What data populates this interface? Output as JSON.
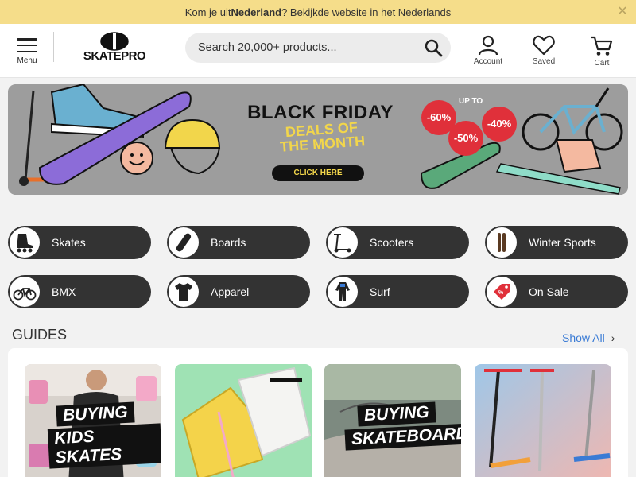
{
  "notice": {
    "prefix": "Kom je uit ",
    "country": "Nederland",
    "middle": "? Bekijk ",
    "link": "de website in het Nederlands"
  },
  "header": {
    "menu_label": "Menu",
    "logo_text": "SKATEPRO",
    "search_placeholder": "Search 20,000+ products...",
    "account_label": "Account",
    "saved_label": "Saved",
    "cart_label": "Cart"
  },
  "banner": {
    "title": "BLACK FRIDAY",
    "subtitle_line1": "DEALS OF",
    "subtitle_line2": "THE MONTH",
    "cta": "CLICK HERE",
    "up_to": "UP TO",
    "discounts": [
      "-60%",
      "-50%",
      "-40%"
    ]
  },
  "categories": [
    {
      "label": "Skates",
      "icon": "inline-skate-icon"
    },
    {
      "label": "Boards",
      "icon": "skateboard-icon"
    },
    {
      "label": "Scooters",
      "icon": "scooter-icon"
    },
    {
      "label": "Winter Sports",
      "icon": "skis-icon"
    },
    {
      "label": "BMX",
      "icon": "bmx-bike-icon"
    },
    {
      "label": "Apparel",
      "icon": "tshirt-icon"
    },
    {
      "label": "Surf",
      "icon": "wetsuit-icon"
    },
    {
      "label": "On Sale",
      "icon": "sale-tag-icon"
    }
  ],
  "guides": {
    "heading": "GUIDES",
    "show_all": "Show All",
    "cards": [
      {
        "line1": "BUYING",
        "line2": "KIDS SKATES"
      },
      {
        "line1": "",
        "line2": ""
      },
      {
        "line1": "BUYING",
        "line2": "SKATEBOARDS"
      },
      {
        "line1": "",
        "line2": ""
      }
    ]
  },
  "colors": {
    "notice_bg": "#f5dd8a",
    "pill_bg": "#333333",
    "link": "#3a7bd5",
    "sale_red": "#e0303a",
    "banner_yellow": "#f2d64b"
  }
}
